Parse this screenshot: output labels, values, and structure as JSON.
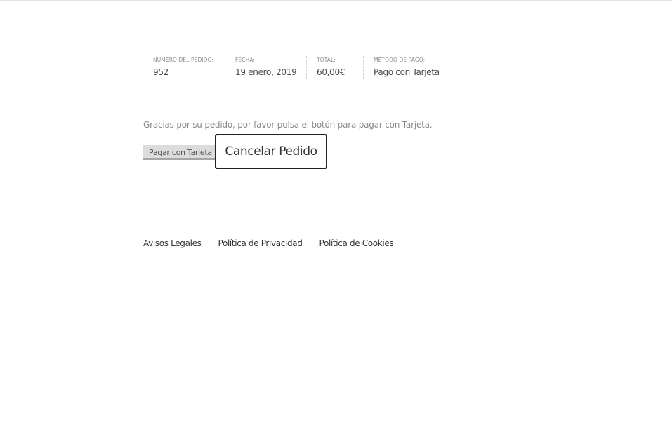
{
  "order_overview": {
    "order_number_label": "NÚMERO DEL PEDIDO:",
    "order_number": "952",
    "date_label": "FECHA:",
    "date": "19 enero, 2019",
    "total_label": "TOTAL:",
    "total": "60,00€",
    "payment_method_label": "MÉTODO DE PAGO:",
    "payment_method": "Pago con Tarjeta"
  },
  "payment": {
    "message": "Gracias por su pedido, por favor pulsa el botón para pagar con Tarjeta.",
    "pay_button": "Pagar con Tarjeta",
    "cancel_button": "Cancelar Pedido"
  },
  "footer": {
    "links": [
      "Avisos Legales",
      "Política de Privacidad",
      "Política de Cookies"
    ]
  }
}
